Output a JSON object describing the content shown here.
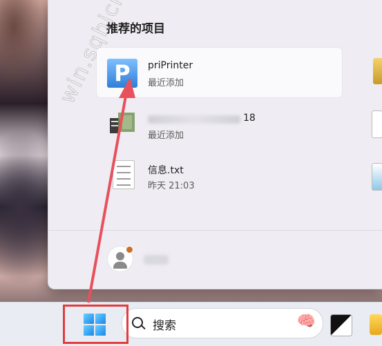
{
  "start_menu": {
    "section_title": "推荐的项目",
    "items": [
      {
        "title": "priPrinter",
        "subtitle": "最近添加",
        "icon": "priprinter-app-icon",
        "icon_letter": "P"
      },
      {
        "title_suffix": "18",
        "subtitle": "最近添加",
        "icon": "blurred-app-icon"
      },
      {
        "title": "信息.txt",
        "subtitle": "昨天 21:03",
        "icon": "text-file-icon"
      }
    ]
  },
  "taskbar": {
    "search_placeholder": "搜索",
    "search_deco": "🧠",
    "start_icon": "windows-logo-icon"
  },
  "watermark": "win.sqhicrs.cc",
  "colors": {
    "highlight_box": "#e23c3c",
    "arrow": "#e8505b",
    "accent": "#1b86e8"
  }
}
